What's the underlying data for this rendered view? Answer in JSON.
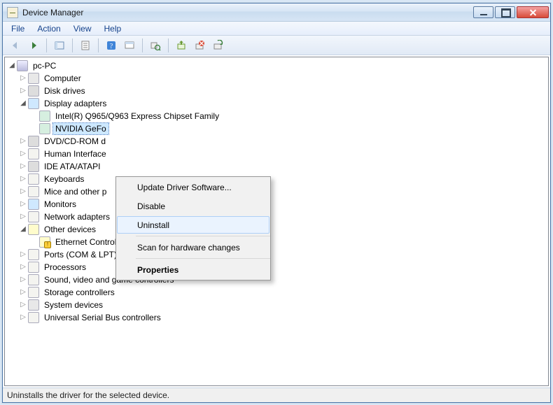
{
  "window": {
    "title": "Device Manager"
  },
  "menu": {
    "file": "File",
    "action": "Action",
    "view": "View",
    "help": "Help"
  },
  "toolbar_icons": {
    "back": "back-icon",
    "forward": "forward-icon",
    "show": "show-hide-icon",
    "properties": "properties-icon",
    "help": "help-icon",
    "console": "console-icon",
    "scan": "scan-icon",
    "update": "update-icon",
    "uninstall": "uninstall-icon",
    "disable": "disable-icon"
  },
  "tree": {
    "root": "pc-PC",
    "computer": "Computer",
    "disk": "Disk drives",
    "display": "Display adapters",
    "display_children": {
      "intel": "Intel(R)  Q965/Q963 Express Chipset Family",
      "nvidia": "NVIDIA GeFo"
    },
    "dvd": "DVD/CD-ROM d",
    "human": "Human Interface",
    "ide": "IDE ATA/ATAPI",
    "keyboards": "Keyboards",
    "mice": "Mice and other p",
    "monitors": "Monitors",
    "network": "Network adapters",
    "other": "Other devices",
    "other_children": {
      "ethernet": "Ethernet Controller"
    },
    "ports": "Ports (COM & LPT)",
    "processors": "Processors",
    "sound": "Sound, video and game controllers",
    "storage": "Storage controllers",
    "system": "System devices",
    "usb": "Universal Serial Bus controllers"
  },
  "context_menu": {
    "update": "Update Driver Software...",
    "disable": "Disable",
    "uninstall": "Uninstall",
    "scan": "Scan for hardware changes",
    "properties": "Properties",
    "highlighted": "uninstall"
  },
  "status": "Uninstalls the driver for the selected device."
}
